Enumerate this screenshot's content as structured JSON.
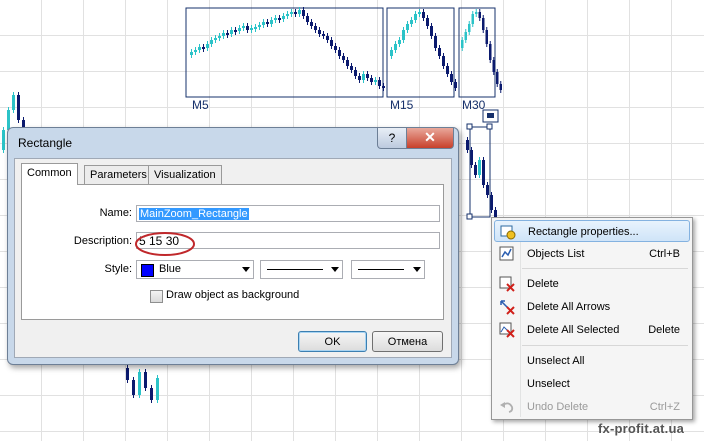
{
  "zoom_labels": [
    "M5",
    "M15",
    "M30"
  ],
  "dialog": {
    "title": "Rectangle",
    "help_label": "?",
    "close_label": "✕",
    "tabs": [
      "Common",
      "Parameters",
      "Visualization"
    ],
    "active_tab": "Common",
    "name_label": "Name:",
    "name_value": "MainZoom_Rectangle",
    "description_label": "Description:",
    "description_value": "5 15 30",
    "style_label": "Style:",
    "style_color_name": "Blue",
    "style_color": "#0000ff",
    "background_label": "Draw object as background",
    "background_checked": false,
    "ok_label": "OK",
    "cancel_label": "Отмена"
  },
  "context_menu": {
    "items": [
      {
        "label": "Rectangle properties...",
        "shortcut": "",
        "icon": "properties-icon",
        "highlighted": true
      },
      {
        "label": "Objects List",
        "shortcut": "Ctrl+B",
        "icon": "objects-list-icon"
      },
      {
        "label": "Delete",
        "shortcut": "",
        "icon": "delete-icon"
      },
      {
        "label": "Delete All Arrows",
        "shortcut": "",
        "icon": "delete-arrows-icon"
      },
      {
        "label": "Delete All Selected",
        "shortcut": "Delete",
        "icon": "delete-selected-icon"
      },
      {
        "label": "Unselect All",
        "shortcut": ""
      },
      {
        "label": "Unselect",
        "shortcut": ""
      },
      {
        "label": "Undo Delete",
        "shortcut": "Ctrl+Z",
        "icon": "undo-icon",
        "disabled": true
      }
    ]
  },
  "watermark": "fx-profit.at.ua",
  "colors": {
    "bull": "#2bc3c8",
    "bear": "#0b1a6e",
    "frame": "#16306b",
    "annotation": "#c0282b"
  }
}
